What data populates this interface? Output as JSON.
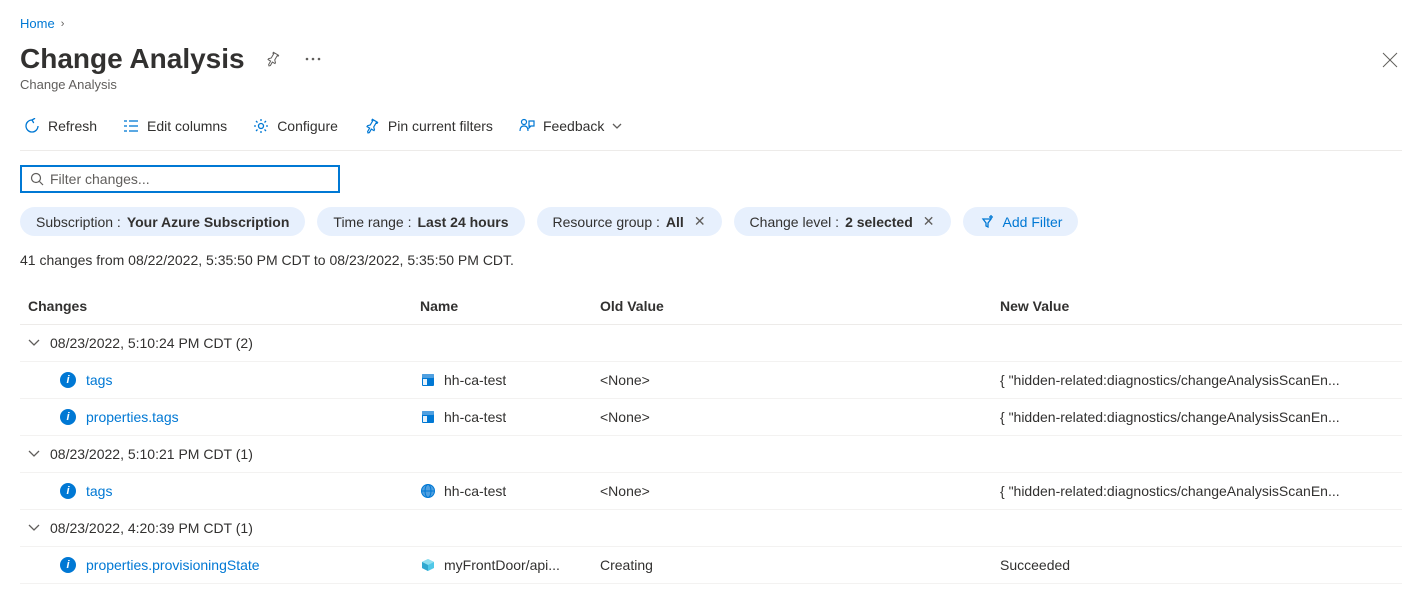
{
  "breadcrumb": {
    "home": "Home"
  },
  "page": {
    "title": "Change Analysis",
    "subtitle": "Change Analysis"
  },
  "toolbar": {
    "refresh": "Refresh",
    "edit_columns": "Edit columns",
    "configure": "Configure",
    "pin_filters": "Pin current filters",
    "feedback": "Feedback"
  },
  "filter": {
    "placeholder": "Filter changes..."
  },
  "pills": {
    "subscription_label": "Subscription : ",
    "subscription_value": "Your Azure Subscription",
    "time_range_label": "Time range : ",
    "time_range_value": "Last 24 hours",
    "resource_group_label": "Resource group : ",
    "resource_group_value": "All",
    "change_level_label": "Change level : ",
    "change_level_value": "2 selected",
    "add_filter": "Add Filter"
  },
  "status": "41 changes from 08/22/2022, 5:35:50 PM CDT to 08/23/2022, 5:35:50 PM CDT.",
  "columns": {
    "changes": "Changes",
    "name": "Name",
    "old_value": "Old Value",
    "new_value": "New Value"
  },
  "groups": [
    {
      "header": "08/23/2022, 5:10:24 PM CDT (2)",
      "rows": [
        {
          "change": "tags",
          "icon": "webapp",
          "name": "hh-ca-test",
          "old": "<None>",
          "new": "{ \"hidden-related:diagnostics/changeAnalysisScanEn..."
        },
        {
          "change": "properties.tags",
          "icon": "webapp",
          "name": "hh-ca-test",
          "old": "<None>",
          "new": "{ \"hidden-related:diagnostics/changeAnalysisScanEn..."
        }
      ]
    },
    {
      "header": "08/23/2022, 5:10:21 PM CDT (1)",
      "rows": [
        {
          "change": "tags",
          "icon": "globe",
          "name": "hh-ca-test",
          "old": "<None>",
          "new": "{ \"hidden-related:diagnostics/changeAnalysisScanEn..."
        }
      ]
    },
    {
      "header": "08/23/2022, 4:20:39 PM CDT (1)",
      "rows": [
        {
          "change": "properties.provisioningState",
          "icon": "cube",
          "name": "myFrontDoor/api...",
          "old": "Creating",
          "new": "Succeeded"
        }
      ]
    }
  ]
}
